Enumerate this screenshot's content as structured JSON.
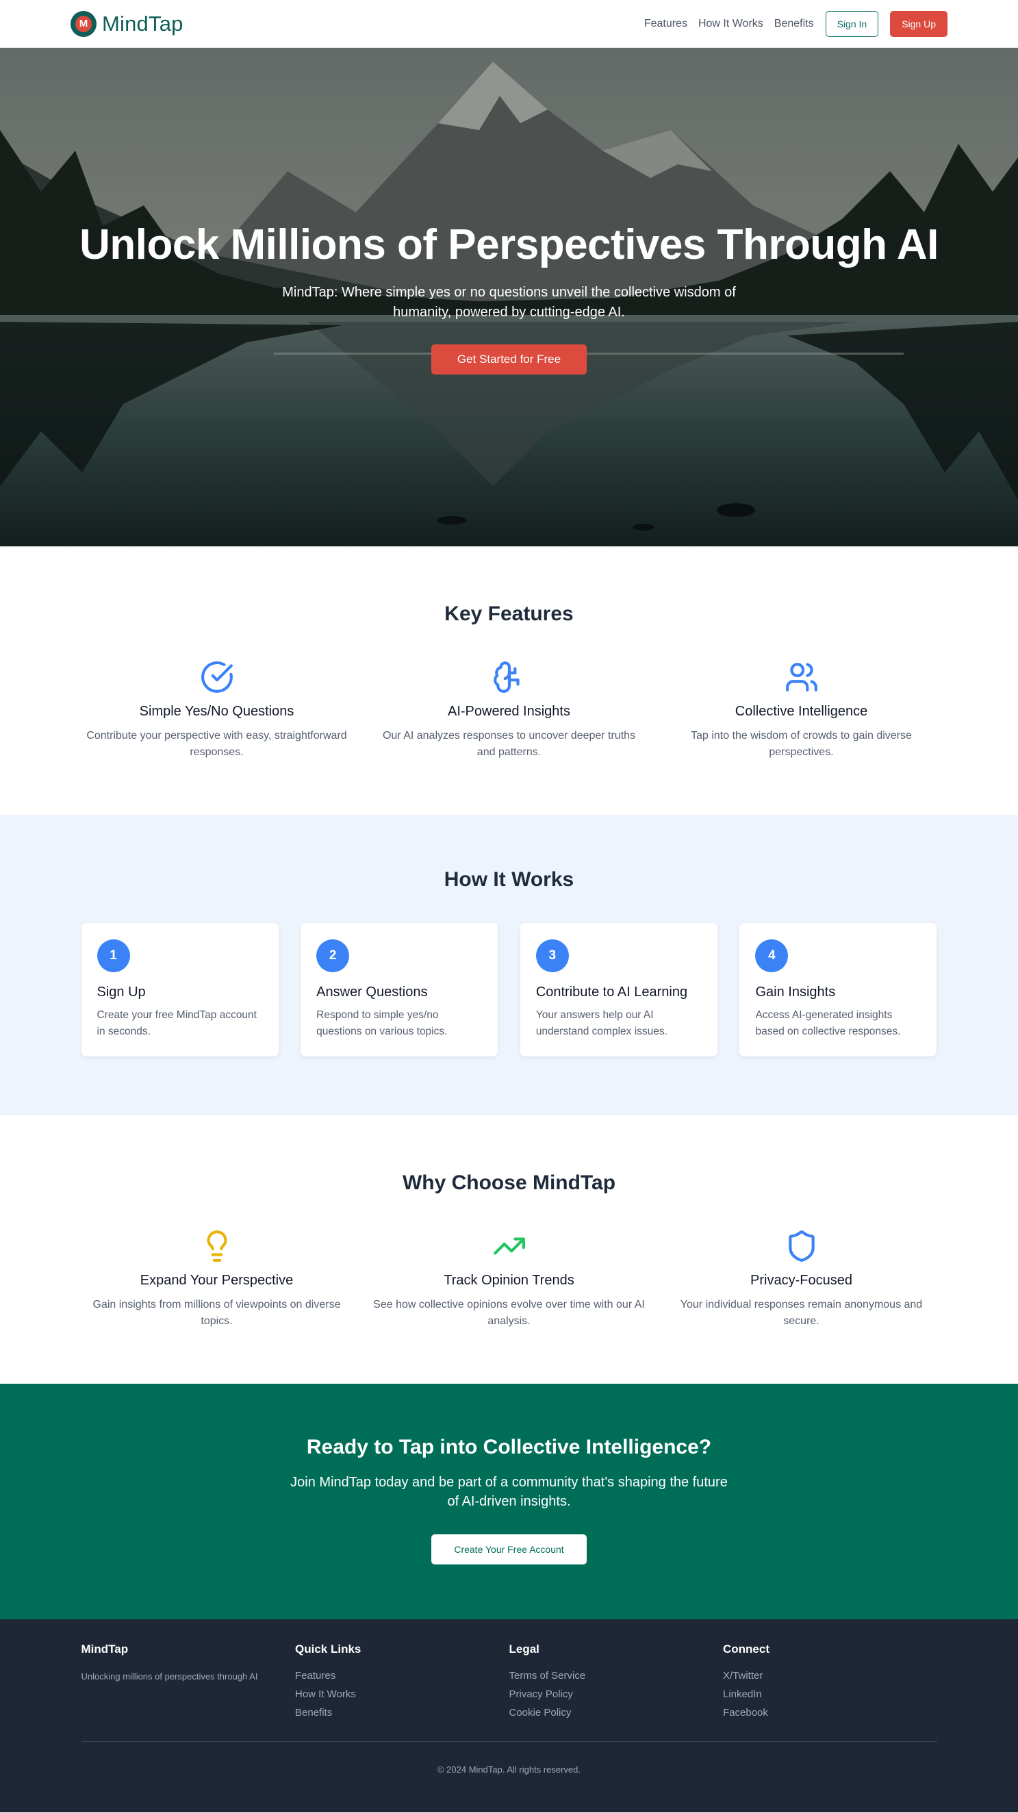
{
  "nav": {
    "brand": "MindTap",
    "logo_letter": "M",
    "links": [
      "Features",
      "How It Works",
      "Benefits"
    ],
    "sign_in": "Sign In",
    "sign_up": "Sign Up"
  },
  "hero": {
    "title": "Unlock Millions of Perspectives Through AI",
    "subtitle": "MindTap: Where simple yes or no questions unveil the collective wisdom of humanity, powered by cutting-edge AI.",
    "cta": "Get Started for Free"
  },
  "features": {
    "title": "Key Features",
    "items": [
      {
        "icon": "check-circle-icon",
        "title": "Simple Yes/No Questions",
        "desc": "Contribute your perspective with easy, straightforward responses."
      },
      {
        "icon": "brain-icon",
        "title": "AI-Powered Insights",
        "desc": "Our AI analyzes responses to uncover deeper truths and patterns."
      },
      {
        "icon": "users-icon",
        "title": "Collective Intelligence",
        "desc": "Tap into the wisdom of crowds to gain diverse perspectives."
      }
    ]
  },
  "how": {
    "title": "How It Works",
    "steps": [
      {
        "num": "1",
        "title": "Sign Up",
        "desc": "Create your free MindTap account in seconds."
      },
      {
        "num": "2",
        "title": "Answer Questions",
        "desc": "Respond to simple yes/no questions on various topics."
      },
      {
        "num": "3",
        "title": "Contribute to AI Learning",
        "desc": "Your answers help our AI understand complex issues."
      },
      {
        "num": "4",
        "title": "Gain Insights",
        "desc": "Access AI-generated insights based on collective responses."
      }
    ]
  },
  "why": {
    "title": "Why Choose MindTap",
    "items": [
      {
        "icon": "lightbulb-icon",
        "title": "Expand Your Perspective",
        "desc": "Gain insights from millions of viewpoints on diverse topics."
      },
      {
        "icon": "trending-up-icon",
        "title": "Track Opinion Trends",
        "desc": "See how collective opinions evolve over time with our AI analysis."
      },
      {
        "icon": "shield-icon",
        "title": "Privacy-Focused",
        "desc": "Your individual responses remain anonymous and secure."
      }
    ]
  },
  "cta": {
    "title": "Ready to Tap into Collective Intelligence?",
    "text": "Join MindTap today and be part of a community that's shaping the future of AI-driven insights.",
    "button": "Create Your Free Account"
  },
  "footer": {
    "brand": "MindTap",
    "tagline": "Unlocking millions of perspectives through AI",
    "quick_title": "Quick Links",
    "quick": [
      "Features",
      "How It Works",
      "Benefits"
    ],
    "legal_title": "Legal",
    "legal": [
      "Terms of Service",
      "Privacy Policy",
      "Cookie Policy"
    ],
    "connect_title": "Connect",
    "connect": [
      "X/Twitter",
      "LinkedIn",
      "Facebook"
    ],
    "copyright": "© 2024 MindTap. All rights reserved."
  },
  "colors": {
    "brand_teal": "#0f5e57",
    "accent_red": "#dc4b3e",
    "step_blue": "#3b82f6",
    "cta_green": "#006e57",
    "footer_bg": "#1f2737"
  }
}
